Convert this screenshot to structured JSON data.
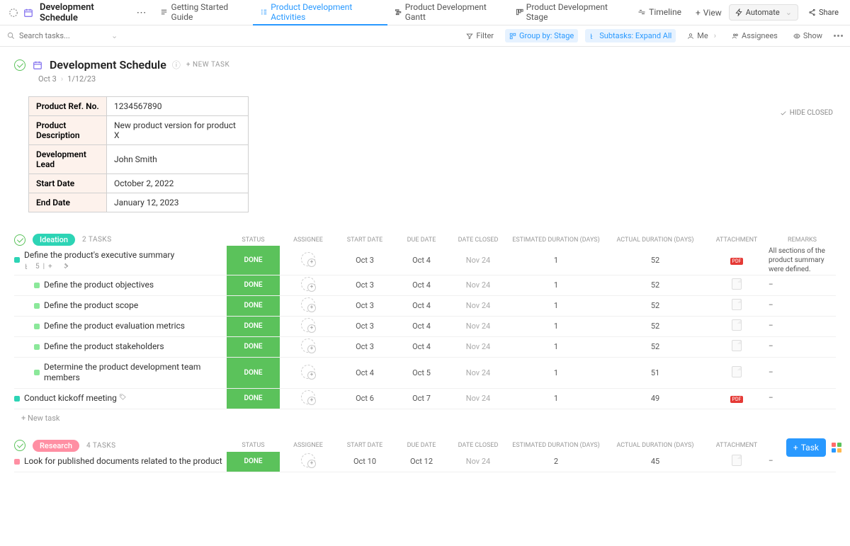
{
  "topbar": {
    "doc_title": "Development Schedule",
    "tabs": [
      "Getting Started Guide",
      "Product Development Activities",
      "Product Development Gantt",
      "Product Development Stage",
      "Timeline"
    ],
    "add_view": "View",
    "automate": "Automate",
    "share": "Share"
  },
  "toolrow": {
    "search_placeholder": "Search tasks...",
    "filter": "Filter",
    "group_by": "Group by: Stage",
    "subtasks": "Subtasks: Expand All",
    "me": "Me",
    "assignees": "Assignees",
    "show": "Show"
  },
  "header": {
    "title": "Development Schedule",
    "new_task": "+ NEW TASK",
    "start": "Oct 3",
    "end": "1/12/23",
    "hide_closed": "HIDE CLOSED"
  },
  "info": {
    "rows": [
      [
        "Product Ref. No.",
        "1234567890"
      ],
      [
        "Product Description",
        "New product version for product X"
      ],
      [
        "Development Lead",
        "John Smith"
      ],
      [
        "Start Date",
        "October 2, 2022"
      ],
      [
        "End Date",
        "January 12, 2023"
      ]
    ]
  },
  "columns": [
    "",
    "STATUS",
    "ASSIGNEE",
    "START DATE",
    "DUE DATE",
    "DATE CLOSED",
    "ESTIMATED DURATION (DAYS)",
    "ACTUAL DURATION (DAYS)",
    "ATTACHMENT",
    "REMARKS"
  ],
  "groups": [
    {
      "name": "Ideation",
      "pill": "pill-teal",
      "count": "2 TASKS",
      "tasks": [
        {
          "name": "Define the product's executive summary",
          "sub": false,
          "bullet": "b-green",
          "status": "DONE",
          "start": "Oct 3",
          "due": "Oct 4",
          "closed": "Nov 24",
          "est": "1",
          "act": "52",
          "attach": "pdf",
          "remarks": "All sections of the product summary were defined.",
          "meta": true
        },
        {
          "name": "Define the product objectives",
          "sub": true,
          "bullet": "b-greenL",
          "status": "DONE",
          "start": "Oct 3",
          "due": "Oct 4",
          "closed": "Nov 24",
          "est": "1",
          "act": "52",
          "attach": "blank",
          "remarks": "–"
        },
        {
          "name": "Define the product scope",
          "sub": true,
          "bullet": "b-greenL",
          "status": "DONE",
          "start": "Oct 3",
          "due": "Oct 4",
          "closed": "Nov 24",
          "est": "1",
          "act": "52",
          "attach": "blank",
          "remarks": "–"
        },
        {
          "name": "Define the product evaluation metrics",
          "sub": true,
          "bullet": "b-greenL",
          "status": "DONE",
          "start": "Oct 3",
          "due": "Oct 4",
          "closed": "Nov 24",
          "est": "1",
          "act": "52",
          "attach": "blank",
          "remarks": "–"
        },
        {
          "name": "Define the product stakeholders",
          "sub": true,
          "bullet": "b-greenL",
          "status": "DONE",
          "start": "Oct 3",
          "due": "Oct 4",
          "closed": "Nov 24",
          "est": "1",
          "act": "52",
          "attach": "blank",
          "remarks": "–"
        },
        {
          "name": "Determine the product development team members",
          "sub": true,
          "bullet": "b-greenL",
          "status": "DONE",
          "start": "Oct 4",
          "due": "Oct 5",
          "closed": "Nov 24",
          "est": "1",
          "act": "51",
          "attach": "blank",
          "remarks": "–"
        },
        {
          "name": "Conduct kickoff meeting",
          "sub": false,
          "bullet": "b-green",
          "status": "DONE",
          "start": "Oct 6",
          "due": "Oct 7",
          "closed": "Nov 24",
          "est": "1",
          "act": "49",
          "attach": "pdf",
          "remarks": "–",
          "tag": true
        }
      ]
    },
    {
      "name": "Research",
      "pill": "pill-pink",
      "count": "4 TASKS",
      "tasks": [
        {
          "name": "Look for published documents related to the product",
          "sub": false,
          "bullet": "b-pink",
          "status": "DONE",
          "start": "Oct 10",
          "due": "Oct 12",
          "closed": "Nov 24",
          "est": "2",
          "act": "45",
          "attach": "blank",
          "remarks": "–"
        }
      ]
    }
  ],
  "new_task_row": "+ New task",
  "fab": {
    "task": "Task"
  }
}
